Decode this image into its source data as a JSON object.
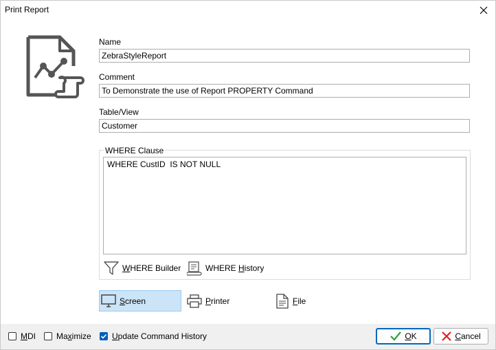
{
  "window": {
    "title": "Print Report"
  },
  "icons": {
    "close": "close-icon",
    "report": "report-chart-icon",
    "where_builder": "funnel-icon",
    "where_history": "history-scroll-icon",
    "screen": "monitor-icon",
    "printer": "printer-icon",
    "file": "document-icon",
    "ok": "checkmark-icon",
    "cancel": "x-icon"
  },
  "form": {
    "name": {
      "label": "Name",
      "value": "ZebraStyleReport"
    },
    "comment": {
      "label": "Comment",
      "value": "To Demonstrate the use of Report PROPERTY Command"
    },
    "table_view": {
      "label": "Table/View",
      "value": "Customer"
    }
  },
  "where": {
    "legend": "WHERE Clause",
    "value": "WHERE CustID  IS NOT NULL",
    "builder": {
      "key": "W",
      "rest": "HERE Builder"
    },
    "history": {
      "before": "WHERE ",
      "key": "H",
      "rest": "istory"
    }
  },
  "output": {
    "selected": "Screen",
    "screen": {
      "key": "S",
      "rest": "creen"
    },
    "printer": {
      "key": "P",
      "rest": "rinter"
    },
    "file": {
      "key": "F",
      "rest": "ile"
    }
  },
  "footer": {
    "mdi": {
      "key": "M",
      "rest": "DI",
      "checked": false
    },
    "maximize": {
      "before": "Ma",
      "key": "x",
      "rest": "imize",
      "checked": false
    },
    "update_history": {
      "key": "U",
      "rest": "pdate Command History",
      "checked": true
    },
    "ok": {
      "key": "O",
      "rest": "K"
    },
    "cancel": {
      "key": "C",
      "rest": "ancel"
    }
  },
  "colors": {
    "accent": "#005fb8",
    "selected_bg": "#cce4f7",
    "cancel_red": "#e02020",
    "ok_green": "#2e9e3e",
    "footer_bg": "#f0f0f0"
  }
}
